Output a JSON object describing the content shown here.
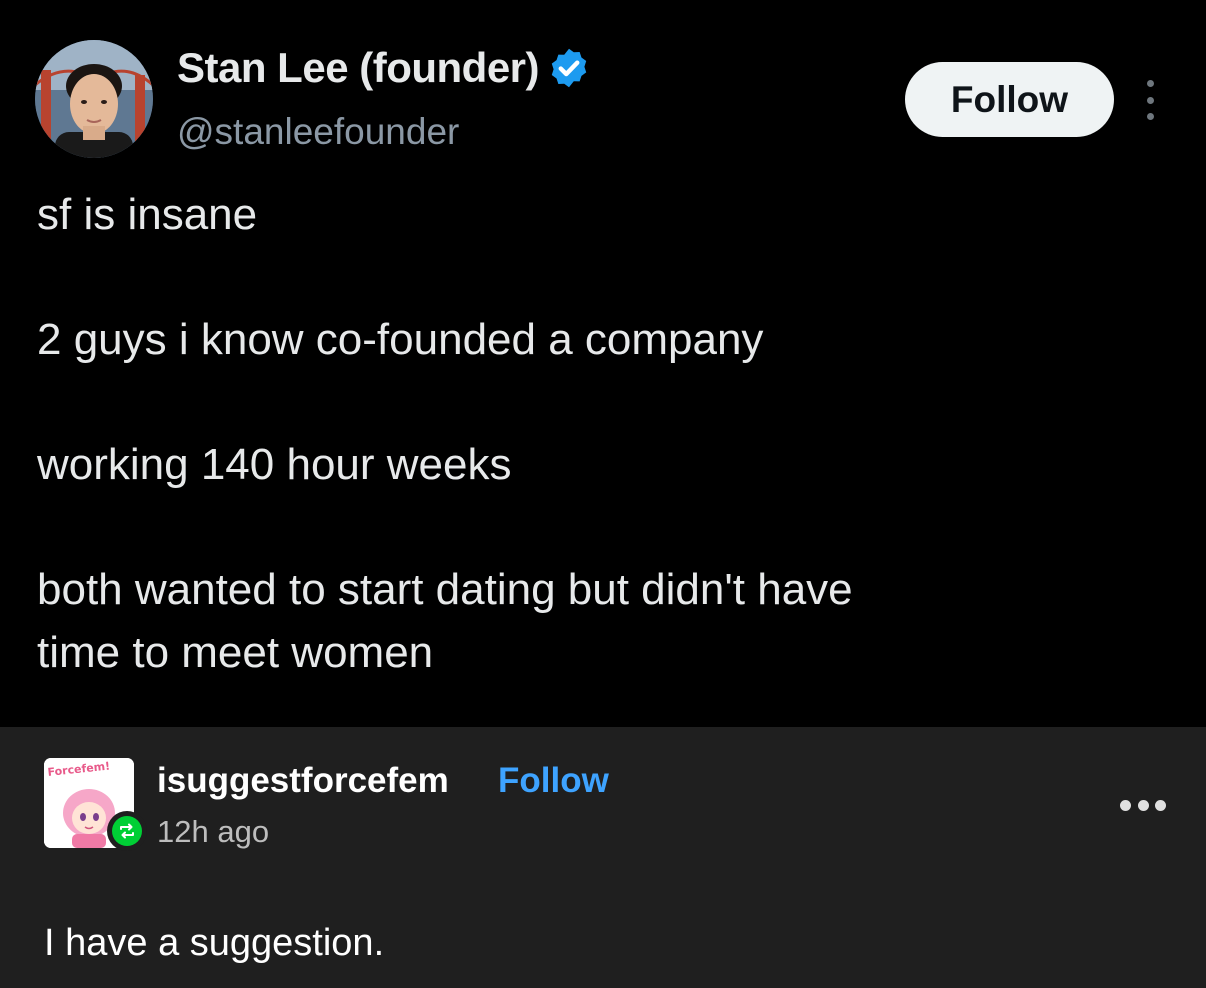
{
  "tweet": {
    "display_name": "Stan Lee (founder)",
    "handle": "@stanleefounder",
    "follow_label": "Follow",
    "lines": [
      "sf is insane",
      "2 guys i know co-founded a company",
      "working 140 hour weeks",
      "both wanted to start dating but didn't have",
      "time to meet women"
    ],
    "verified_icon": "verified-badge-icon",
    "colors": {
      "background": "#000000",
      "verified": "#1d9bf0",
      "follow_bg": "#eff3f4"
    }
  },
  "reblog": {
    "blog_name": "isuggestforcefem",
    "follow_label": "Follow",
    "time_ago": "12h ago",
    "avatar_text": "Forcefem!",
    "body_text": "I have a suggestion.",
    "reblog_icon": "reblog-icon",
    "colors": {
      "background": "#1f1f1f",
      "follow": "#3ea3ff",
      "reblog": "#00cf35"
    }
  }
}
